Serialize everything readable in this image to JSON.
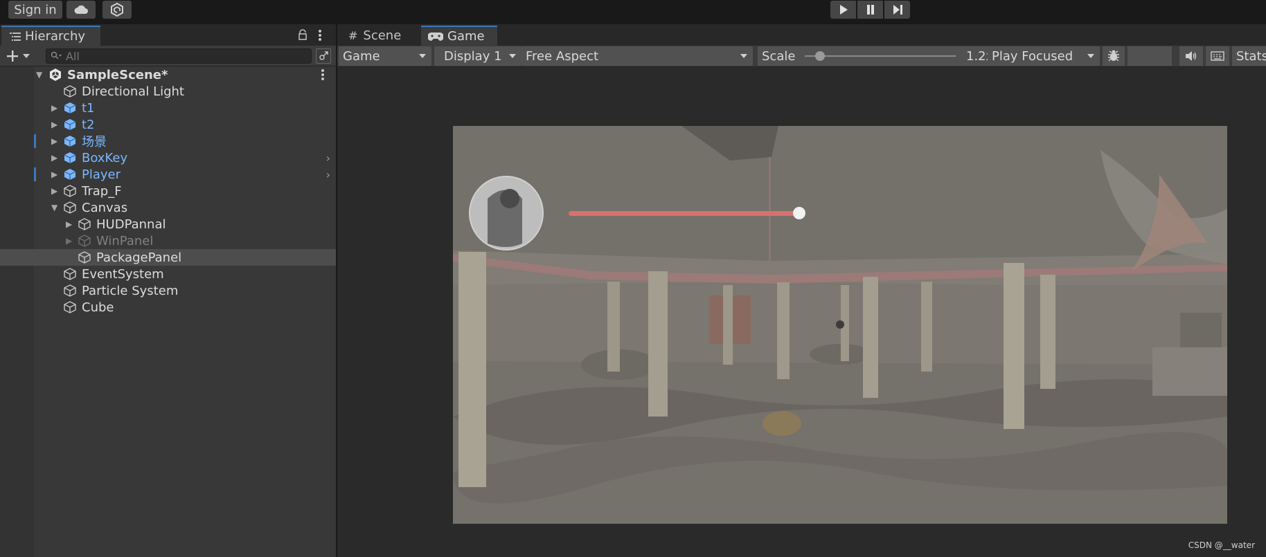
{
  "topbar": {
    "sign_in": "Sign in",
    "cloud_icon": "cloud-icon",
    "collab_icon": "collab-hex-icon",
    "play_icon": "play-icon",
    "pause_icon": "pause-icon",
    "step_icon": "step-icon"
  },
  "hierarchy": {
    "tab_label": "Hierarchy",
    "search_placeholder": "All",
    "scene_name": "SampleScene*",
    "items": [
      {
        "label": "Directional Light"
      },
      {
        "label": "t1"
      },
      {
        "label": "t2"
      },
      {
        "label": "场景"
      },
      {
        "label": "BoxKey"
      },
      {
        "label": "Player"
      },
      {
        "label": "Trap_F"
      },
      {
        "label": "Canvas"
      },
      {
        "label": "HUDPannal"
      },
      {
        "label": "WinPanel"
      },
      {
        "label": "PackagePanel"
      },
      {
        "label": "EventSystem"
      },
      {
        "label": "Particle System"
      },
      {
        "label": "Cube"
      }
    ]
  },
  "tabs": {
    "scene": "Scene",
    "game": "Game"
  },
  "game_toolbar": {
    "view_select": "Game",
    "display_select": "Display 1",
    "aspect_select": "Free Aspect",
    "scale_label": "Scale",
    "scale_value": "1.2x",
    "scale_fraction": 0.1,
    "play_mode_select": "Play Focused",
    "stats_label": "Stats"
  },
  "game_view": {
    "health_fraction": 1.0,
    "health_color": "#d9706e"
  },
  "watermark": "CSDN @__water",
  "colors": {
    "accent": "#3a79bb",
    "prefab_blue": "#7ab7ff"
  }
}
